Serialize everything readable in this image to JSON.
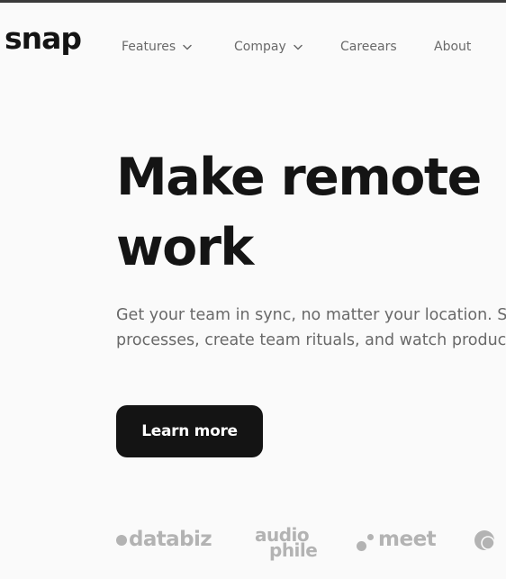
{
  "brand": {
    "logo": "snap"
  },
  "nav": {
    "items": [
      {
        "label": "Features",
        "has_dropdown": true
      },
      {
        "label": "Compay",
        "has_dropdown": true
      },
      {
        "label": "Careears",
        "has_dropdown": false
      },
      {
        "label": "About",
        "has_dropdown": false
      }
    ]
  },
  "hero": {
    "headline": "Make remote\nwork",
    "subtext": "Get your team in sync, no matter your location. Streamline processes, create team rituals, and watch productivity soar.",
    "cta_label": "Learn more"
  },
  "clients": {
    "logos": [
      {
        "name": "databiz",
        "icon": "databiz-logo"
      },
      {
        "name_line1": "audio",
        "name_line2": "phile",
        "icon": "audiophile-logo"
      },
      {
        "name": "meet",
        "icon": "meet-logo"
      },
      {
        "name": "",
        "icon": "maker-logo"
      }
    ]
  },
  "colors": {
    "background": "#fafafa",
    "text_primary": "#141414",
    "text_secondary": "#696969",
    "logo_gray": "#b3b3b3",
    "button_bg": "#141414"
  }
}
